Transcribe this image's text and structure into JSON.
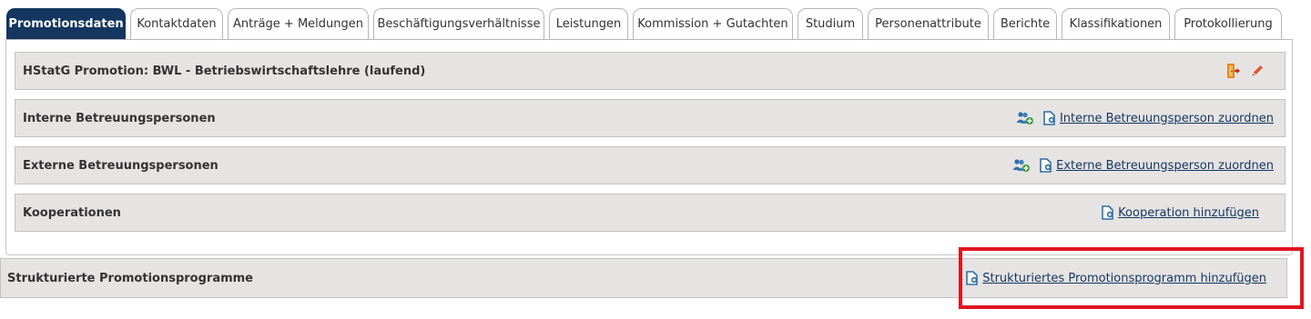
{
  "tabs": [
    {
      "label": "Promotionsdaten",
      "active": true
    },
    {
      "label": "Kontaktdaten",
      "active": false
    },
    {
      "label": "Anträge + Meldungen",
      "active": false
    },
    {
      "label": "Beschäftigungsverhältnisse",
      "active": false
    },
    {
      "label": "Leistungen",
      "active": false
    },
    {
      "label": "Kommission + Gutachten",
      "active": false
    },
    {
      "label": "Studium",
      "active": false
    },
    {
      "label": "Personenattribute",
      "active": false
    },
    {
      "label": "Berichte",
      "active": false
    },
    {
      "label": "Klassifikationen",
      "active": false
    },
    {
      "label": "Protokollierung",
      "active": false
    }
  ],
  "promotion": {
    "title": "HStatG Promotion: BWL - Betriebswirtschaftslehre (laufend)",
    "exit_icon": "exit-door-icon",
    "edit_icon": "pencil-icon"
  },
  "internal": {
    "title": "Interne Betreuungspersonen",
    "action": "Interne Betreuungsperson zuordnen"
  },
  "external": {
    "title": "Externe Betreuungspersonen",
    "action": "Externe Betreuungsperson zuordnen"
  },
  "cooperations": {
    "title": "Kooperationen",
    "action": "Kooperation hinzufügen"
  },
  "structured": {
    "title": "Strukturierte Promotionsprogramme",
    "action": "Strukturiertes Promotionsprogramm hinzufügen"
  },
  "colors": {
    "active_tab": "#14365f",
    "section_bg": "#e6e3e3",
    "link": "#14365f",
    "highlight": "#e0151e",
    "person_icon": "#2f6fa3",
    "add_icon": "#3f9a3a"
  }
}
